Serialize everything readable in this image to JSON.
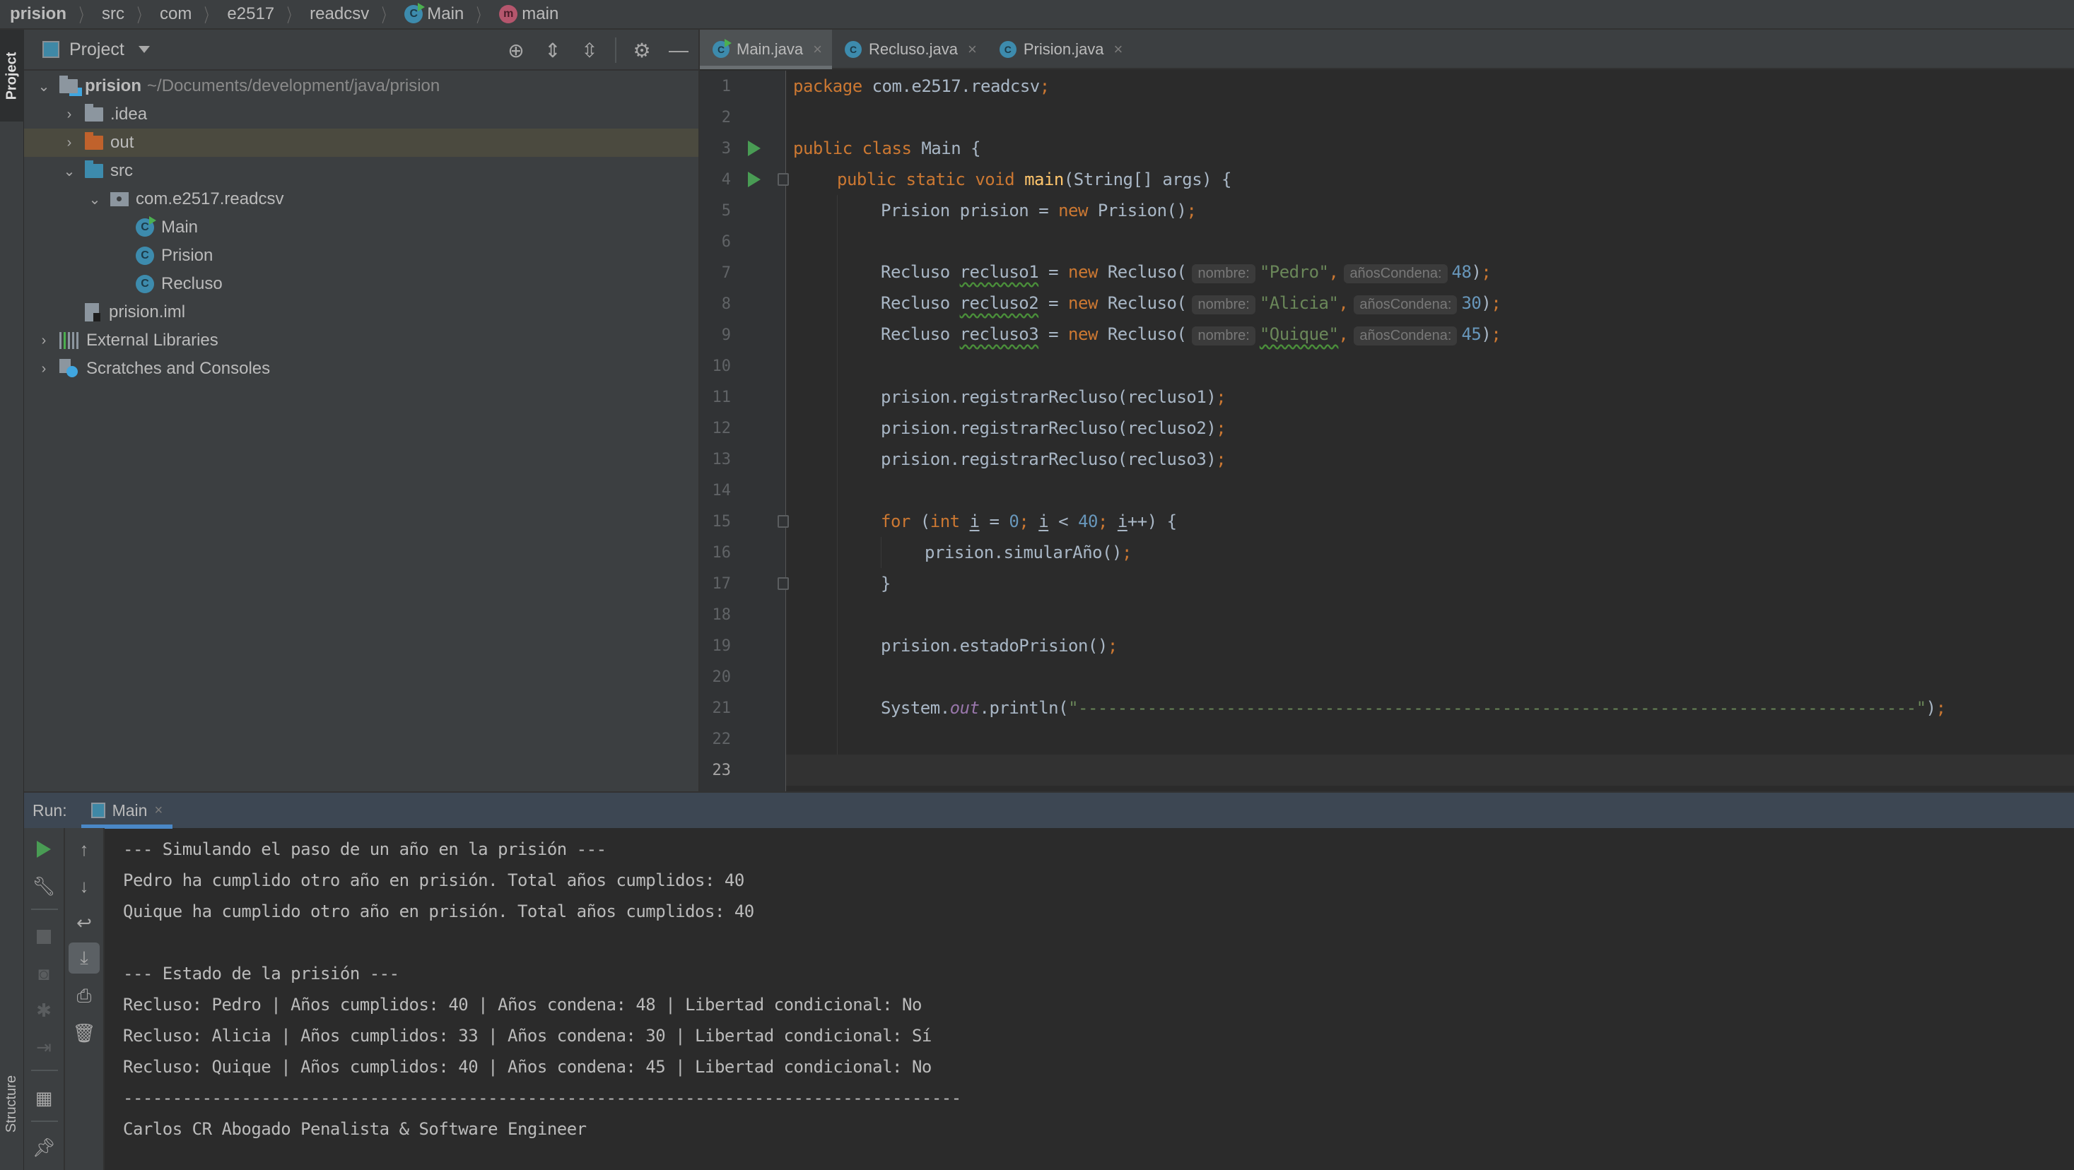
{
  "breadcrumb": {
    "items": [
      {
        "label": "prision",
        "icon": null
      },
      {
        "label": "src",
        "icon": null
      },
      {
        "label": "com",
        "icon": null
      },
      {
        "label": "e2517",
        "icon": null
      },
      {
        "label": "readcsv",
        "icon": null
      },
      {
        "label": "Main",
        "icon": "class-icon"
      },
      {
        "label": "main",
        "icon": "method-icon"
      }
    ]
  },
  "left_strip": {
    "project_tab": "Project",
    "structure_tab": "Structure"
  },
  "project_panel": {
    "title": "Project",
    "tools": [
      "locate-icon",
      "expand-all-icon",
      "collapse-all-icon",
      "gear-icon",
      "minimize-icon"
    ],
    "tree": [
      {
        "label": "prision",
        "path": "~/Documents/development/java/prision",
        "icon": "module-folder-icon",
        "expanded": true,
        "depth": 0
      },
      {
        "label": ".idea",
        "icon": "folder-icon",
        "expanded": false,
        "depth": 1
      },
      {
        "label": "out",
        "icon": "excluded-folder-icon",
        "expanded": false,
        "depth": 1,
        "selected": true
      },
      {
        "label": "src",
        "icon": "source-folder-icon",
        "expanded": true,
        "depth": 1
      },
      {
        "label": "com.e2517.readcsv",
        "icon": "package-icon",
        "expanded": true,
        "depth": 2
      },
      {
        "label": "Main",
        "icon": "class-icon",
        "depth": 3
      },
      {
        "label": "Prision",
        "icon": "class-icon",
        "depth": 3
      },
      {
        "label": "Recluso",
        "icon": "class-icon",
        "depth": 3
      },
      {
        "label": "prision.iml",
        "icon": "file-icon",
        "depth": 1
      },
      {
        "label": "External Libraries",
        "icon": "library-icon",
        "expanded": false,
        "depth": 0
      },
      {
        "label": "Scratches and Consoles",
        "icon": "scratches-icon",
        "expanded": false,
        "depth": 0
      }
    ]
  },
  "editor": {
    "tabs": [
      {
        "label": "Main.java",
        "active": true
      },
      {
        "label": "Recluso.java",
        "active": false
      },
      {
        "label": "Prision.java",
        "active": false
      }
    ],
    "current_line": 23,
    "lines": [
      "package com.e2517.readcsv;",
      "",
      "public class Main {",
      "    public static void main(String[] args) {",
      "        Prision prision = new Prision();",
      "",
      "        Recluso recluso1 = new Recluso( nombre: \"Pedro\",  añosCondena: 48);",
      "        Recluso recluso2 = new Recluso( nombre: \"Alicia\",  añosCondena: 30);",
      "        Recluso recluso3 = new Recluso( nombre: \"Quique\",  añosCondena: 45);",
      "",
      "        prision.registrarRecluso(recluso1);",
      "        prision.registrarRecluso(recluso2);",
      "        prision.registrarRecluso(recluso3);",
      "",
      "        for (int i = 0; i < 40; i++) {",
      "            prision.simularAño();",
      "        }",
      "",
      "        prision.estadoPrision();",
      "",
      "        System.out.println(\"-------------------------------------------------------------------------------------\");",
      "",
      ""
    ],
    "reclusos": [
      {
        "var": "recluso1",
        "nombre": "\"Pedro\"",
        "anos": "48"
      },
      {
        "var": "recluso2",
        "nombre": "\"Alicia\"",
        "anos": "30"
      },
      {
        "var": "recluso3",
        "nombre": "\"Quique\"",
        "anos": "45"
      }
    ],
    "hints": {
      "nombre": "nombre:",
      "anos": "añosCondena:"
    },
    "tokens": {
      "package_kw": "package",
      "package_name": "com.e2517.readcsv",
      "public": "public",
      "class": "class",
      "static": "static",
      "void": "void",
      "new": "new",
      "for": "for",
      "int": "int",
      "class_name": "Main",
      "main": "main",
      "main_args": "(String[] args) {",
      "prision_decl": "Prision prision = ",
      "prision_ctor": "Prision()",
      "recluso_type": "Recluso ",
      "recluso_ctor": "Recluso(",
      "reg1": "prision.registrarRecluso(recluso1)",
      "reg2": "prision.registrarRecluso(recluso2)",
      "reg3": "prision.registrarRecluso(recluso3)",
      "simular": "prision.simularAño()",
      "estado": "prision.estadoPrision()",
      "system": "System.",
      "out": "out",
      "println": ".println(",
      "sep_string": "\"-------------------------------------------------------------------------------------\"",
      "loop_start": "0",
      "loop_end": "40",
      "loop_var": "i"
    }
  },
  "run_panel": {
    "label": "Run:",
    "tab": "Main",
    "tools_left": [
      "rerun-icon",
      "wrench-icon",
      "stop-icon",
      "camera-icon",
      "debug-icon",
      "login-icon",
      "layout-icon",
      "pin-icon"
    ],
    "tools_right": [
      "up-arrow-icon",
      "down-arrow-icon",
      "soft-wrap-icon",
      "scroll-to-end-icon",
      "print-icon",
      "trash-icon"
    ],
    "console": [
      "--- Simulando el paso de un año en la prisión ---",
      "Pedro ha cumplido otro año en prisión. Total años cumplidos: 40",
      "Quique ha cumplido otro año en prisión. Total años cumplidos: 40",
      "",
      "--- Estado de la prisión ---",
      "Recluso: Pedro | Años cumplidos: 40 | Años condena: 48 | Libertad condicional: No",
      "Recluso: Alicia | Años cumplidos: 33 | Años condena: 30 | Libertad condicional: Sí",
      "Recluso: Quique | Años cumplidos: 40 | Años condena: 45 | Libertad condicional: No",
      "-------------------------------------------------------------------------------------",
      "Carlos CR Abogado Penalista & Software Engineer"
    ]
  },
  "colors": {
    "keyword": "#cc7832",
    "string": "#6a8759",
    "number": "#6897bb",
    "function": "#ffc66d",
    "static_field": "#9876aa",
    "run_green": "#499c54",
    "selection_accent": "#4a88c7"
  }
}
